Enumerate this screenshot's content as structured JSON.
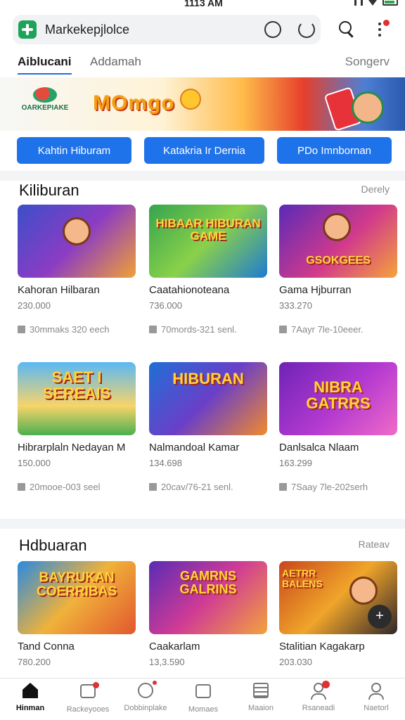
{
  "status": {
    "time": "1113 AM"
  },
  "browser": {
    "url": "Markekepjlolce"
  },
  "tabs": [
    {
      "label": "Aiblucani"
    },
    {
      "label": "Addamah"
    },
    {
      "label": "Songerv"
    }
  ],
  "banner": {
    "logo_text": "OARKEPIAKE",
    "brand": "MOmgo"
  },
  "chips": [
    {
      "label": "Kahtin Hiburam"
    },
    {
      "label": "Katakria Ir Dernia"
    },
    {
      "label": "PDo Imnbornan"
    }
  ],
  "sections": [
    {
      "title": "Kiliburan",
      "link": "Derely",
      "cards": [
        {
          "thumb_text": "",
          "name": "Kahoran Hilbaran",
          "price": "230.000",
          "meta": "30mmaks 320 eech"
        },
        {
          "thumb_text": "HIBAAR HIBURAN GAME",
          "name": "Caatahionoteana",
          "price": "736.000",
          "meta": "70mords-321 senl."
        },
        {
          "thumb_text": "GSOKGEES",
          "name": "Gama Hjburran",
          "price": "333.270",
          "meta": "7Aayr 7le-10eeer."
        }
      ]
    },
    {
      "title": "",
      "link": "",
      "cards": [
        {
          "thumb_text": "SAET I SEREAIS",
          "name": "Hibrarplaln Nedayan M",
          "price": "150.000",
          "meta": "20mooe-003 seel"
        },
        {
          "thumb_text": "HIBURAN",
          "name": "Nalmandoal Kamar",
          "price": "134.698",
          "meta": "20cav/76-21 senl."
        },
        {
          "thumb_text": "NIBRA GATRRS",
          "name": "Danlsalca Nlaam",
          "price": "163.299",
          "meta": "7Saay 7le-202serh"
        }
      ]
    },
    {
      "title": "Hdbuaran",
      "link": "Rateav",
      "cards": [
        {
          "thumb_text": "BAYRUKAN COERRIBAS",
          "name": "Tand Conna",
          "price": "780.200",
          "meta": ""
        },
        {
          "thumb_text": "GAMRNS GALRINS",
          "name": "Caakarlam",
          "price": "13,3.590",
          "meta": ""
        },
        {
          "thumb_text": "AETRR BALENS",
          "name": "Stalitian Kagakarp",
          "price": "203.030",
          "meta": ""
        }
      ]
    }
  ],
  "bottom_nav": [
    {
      "label": "Hinman",
      "icon": "home-icon"
    },
    {
      "label": "Rackeyooes",
      "icon": "store-icon"
    },
    {
      "label": "Dobbinplake",
      "icon": "clock-icon"
    },
    {
      "label": "Momaes",
      "icon": "box-icon"
    },
    {
      "label": "Maaion",
      "icon": "list-icon"
    },
    {
      "label": "Rsaneadi",
      "icon": "profile-badge-icon"
    },
    {
      "label": "Naetorl",
      "icon": "user-icon"
    }
  ]
}
